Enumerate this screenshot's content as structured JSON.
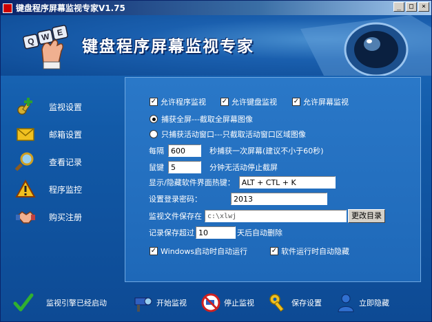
{
  "window": {
    "title": "键盘程序屏幕监视专家V1.75",
    "minimize": "_",
    "maximize": "□",
    "close": "×"
  },
  "banner": {
    "title": "键盘程序屏幕监视专家",
    "logo_keys": [
      "Q",
      "W",
      "E"
    ]
  },
  "sidebar": {
    "items": [
      {
        "label": "监视设置",
        "icon": "key-plus-icon"
      },
      {
        "label": "邮箱设置",
        "icon": "envelope-icon"
      },
      {
        "label": "查看记录",
        "icon": "magnifier-icon"
      },
      {
        "label": "程序监控",
        "icon": "warning-icon"
      },
      {
        "label": "购买注册",
        "icon": "handshake-icon"
      }
    ]
  },
  "settings": {
    "allow_program": {
      "label": "允许程序监视",
      "checked": true
    },
    "allow_keyboard": {
      "label": "允许键盘监视",
      "checked": true
    },
    "allow_screen": {
      "label": "允许屏幕监视",
      "checked": true
    },
    "capture_full": {
      "label": "捕获全屏---截取全屏幕图像",
      "selected": true
    },
    "capture_active": {
      "label": "只捕获活动窗口---只截取活动窗口区域图像",
      "selected": false
    },
    "interval_prefix": "每隔",
    "interval_value": "600",
    "interval_suffix": "秒捕获一次屏幕(建议不小于60秒)",
    "lock_prefix": "鼠键",
    "lock_value": "5",
    "lock_suffix": "分钟无活动停止截屏",
    "hotkey_label": "显示/隐藏软件界面热键：",
    "hotkey_value": "ALT + CTL + K",
    "password_label": "设置登录密码：",
    "password_value": "2013",
    "path_label": "监视文件保存在",
    "path_value": "c:\\xlwj",
    "change_dir": "更改目录",
    "retention_prefix": "记录保存超过",
    "retention_value": "10",
    "retention_suffix": "天后自动删除",
    "autostart": {
      "label": "Windows启动时自动运行",
      "checked": true
    },
    "autohide": {
      "label": "软件运行时自动隐藏",
      "checked": true
    }
  },
  "bottom": {
    "status": "监视引擎已经启动",
    "start": "开始监视",
    "stop": "停止监视",
    "save": "保存设置",
    "hide": "立即隐藏"
  },
  "colors": {
    "background": "#125aa8",
    "panel": "#1e68b8",
    "titlebar": "#0a246a"
  }
}
